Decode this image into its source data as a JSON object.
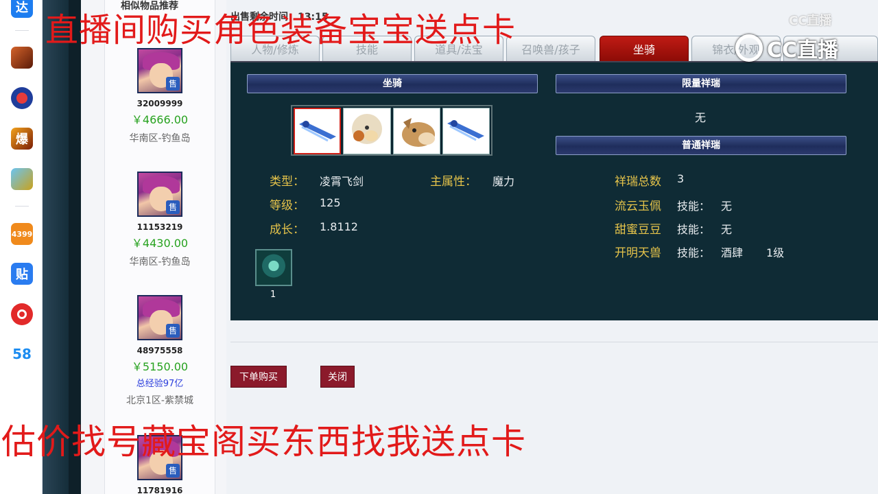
{
  "overlay": {
    "top_caption": "直播间购买角色装备宝宝送点卡",
    "bottom_caption": "估价找号藏宝阁买东西找我送点卡",
    "logo_text": "CC直播",
    "logo_small_text": "CC直播"
  },
  "dock": {
    "items": [
      {
        "icon": "blue-app-icon",
        "label": "达",
        "color": "#1d7df0"
      },
      {
        "icon": "game-dragon-icon",
        "label": "",
        "color": "#8b2c10"
      },
      {
        "icon": "game-ball-icon",
        "label": "",
        "color": "#1f3d9b"
      },
      {
        "icon": "game-explode-icon",
        "label": "爆",
        "color": "#b4320c"
      },
      {
        "icon": "game-slots-icon",
        "label": "",
        "color": "#2b7fc3"
      },
      {
        "icon": "4399-icon",
        "label": "4399",
        "color": "#f08a1c"
      },
      {
        "icon": "tieba-icon",
        "label": "贴",
        "color": "#2a7cf0"
      },
      {
        "icon": "netease-music-icon",
        "label": "",
        "color": "#e22a2a"
      },
      {
        "icon": "58-icon",
        "label": "58",
        "color": "#ffffff"
      }
    ]
  },
  "similar": {
    "title": "相似物品推荐",
    "items": [
      {
        "id": "32009999",
        "price": "￥4666.00",
        "server": "华南区-钓鱼岛"
      },
      {
        "id": "11153219",
        "price": "￥4430.00",
        "server": "华南区-钓鱼岛"
      },
      {
        "id": "48975558",
        "price": "￥5150.00",
        "exp": "总经验97亿",
        "server": "北京1区-紫禁城"
      },
      {
        "id": "11781916",
        "price": "",
        "server": ""
      }
    ],
    "sale_badge": "售"
  },
  "countdown": "出售剩余时间：13:15",
  "tabs": [
    {
      "label": "人物/修炼",
      "active": false
    },
    {
      "label": "技能",
      "active": false
    },
    {
      "label": "道具/法宝",
      "active": false
    },
    {
      "label": "召唤兽/孩子",
      "active": false
    },
    {
      "label": "坐骑",
      "active": true
    },
    {
      "label": "锦衣/外观",
      "active": false
    },
    {
      "label": "家",
      "active": false
    }
  ],
  "mount_panel": {
    "mount_header": "坐骑",
    "limited_header": "限量祥瑞",
    "limited_value": "无",
    "normal_header": "普通祥瑞",
    "mounts": [
      {
        "name": "sword-mount-icon",
        "selected": true
      },
      {
        "name": "sheep-mount-icon",
        "selected": false
      },
      {
        "name": "horse-mount-icon",
        "selected": false
      },
      {
        "name": "sword-mount-icon",
        "selected": false
      }
    ],
    "type_label": "类型：",
    "type_value": "凌霄飞剑",
    "level_label": "等级：",
    "level_value": "125",
    "growth_label": "成长：",
    "growth_value": "1.8112",
    "main_attr_label": "主属性：",
    "main_attr_value": "魔力",
    "skill_count": "1",
    "xiangrui_total_label": "祥瑞总数",
    "xiangrui_total_value": "3",
    "xiangrui": [
      {
        "name": "流云玉佩",
        "skill_label": "技能：",
        "skill": "无",
        "level": ""
      },
      {
        "name": "甜蜜豆豆",
        "skill_label": "技能：",
        "skill": "无",
        "level": ""
      },
      {
        "name": "开明天兽",
        "skill_label": "技能：",
        "skill": "酒肆",
        "level": "1级"
      }
    ]
  },
  "actions": {
    "buy": "下单购买",
    "close": "关闭"
  }
}
